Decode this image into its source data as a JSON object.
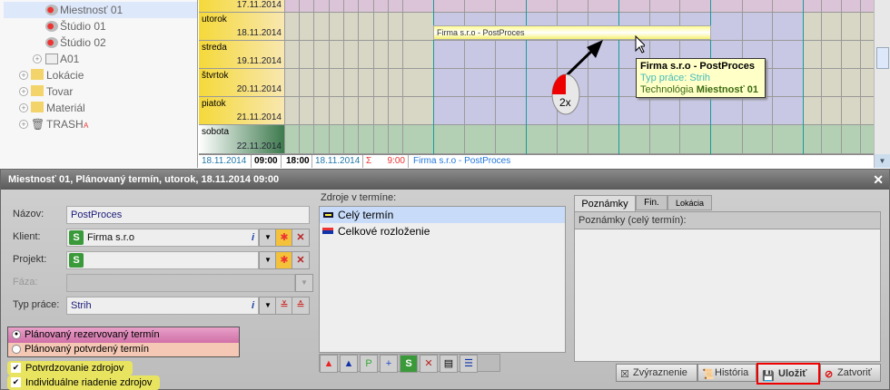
{
  "tree": {
    "items": [
      {
        "label": "Miestnosť 01",
        "icon": "room-icon",
        "selected": true
      },
      {
        "label": "Štúdio 01",
        "icon": "room-icon"
      },
      {
        "label": "Štúdio 02",
        "icon": "room-icon"
      },
      {
        "label": "A01",
        "icon": "computer-icon"
      },
      {
        "label": "Lokácie",
        "icon": "folder-icon"
      },
      {
        "label": "Tovar",
        "icon": "folder-icon"
      },
      {
        "label": "Materiál",
        "icon": "folder-icon"
      },
      {
        "label": "TRASH",
        "icon": "trash-icon",
        "badge": "A"
      }
    ]
  },
  "calendar": {
    "days": [
      {
        "name": "",
        "date": "17.11.2014"
      },
      {
        "name": "utorok",
        "date": "18.11.2014"
      },
      {
        "name": "streda",
        "date": "19.11.2014"
      },
      {
        "name": "štvrtok",
        "date": "20.11.2014"
      },
      {
        "name": "piatok",
        "date": "21.11.2014"
      },
      {
        "name": "sobota",
        "date": "22.11.2014"
      }
    ],
    "event": "Firma s.r.o - PostProces",
    "tooltip": {
      "title": "Firma s.r.o - PostProces",
      "type": "Typ práce: Strih",
      "tech_label": "Technológia",
      "tech_value": "Miestnosť 01"
    },
    "mouse_hint": "2x",
    "status": {
      "start_date": "18.11.2014",
      "start_time": "09:00",
      "end_time": "18:00",
      "end_date": "18.11.2014",
      "sum_icon": "Σ",
      "duration": "9:00",
      "event": "Firma s.r.o - PostProces"
    }
  },
  "dialog": {
    "title": "Miestnosť 01, Plánovaný termín, utorok, 18.11.2014  09:00",
    "fields": {
      "nazov_label": "Názov:",
      "nazov_value": "PostProces",
      "klient_label": "Klient:",
      "klient_value": "Firma s.r.o",
      "projekt_label": "Projekt:",
      "projekt_value": "",
      "faza_label": "Fáza:",
      "faza_value": "",
      "typ_label": "Typ práce:",
      "typ_value": "Strih"
    },
    "radios": [
      {
        "label": "Plánovaný rezervovaný termín",
        "checked": true
      },
      {
        "label": "Plánovaný potvrdený termín",
        "checked": false
      }
    ],
    "checkboxes": [
      {
        "label": "Potvrdzovanie zdrojov",
        "checked": true
      },
      {
        "label": "Individuálne riadenie zdrojov",
        "checked": true
      }
    ],
    "resources_label": "Zdroje v termíne:",
    "resources": [
      "Celý termín",
      "Celkové rozloženie"
    ],
    "tabs": [
      "Poznámky",
      "Fin.",
      "Lokácia"
    ],
    "notes_label": "Poznámky (celý termín):",
    "buttons": {
      "highlight": "Zvýraznenie",
      "history": "História",
      "save": "Uložiť",
      "close": "Zatvoriť"
    }
  }
}
